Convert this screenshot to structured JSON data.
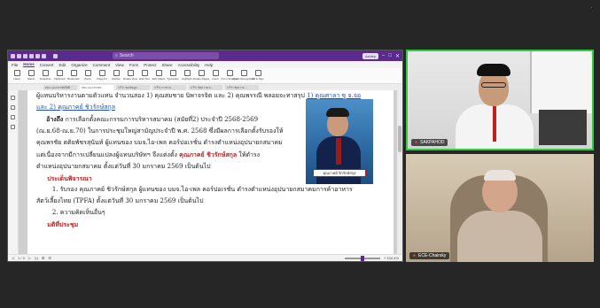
{
  "screen": {
    "background": "#262626",
    "corner_glyph": "·"
  },
  "editor": {
    "accent_color": "#5a2a8c",
    "search_placeholder": "Search",
    "account_pill": "Ashley",
    "window_controls": [
      "–",
      "□",
      "✕"
    ],
    "menu": [
      "File",
      "Home",
      "Convert",
      "Edit",
      "Organize",
      "Comment",
      "View",
      "Form",
      "Protect",
      "Share",
      "Accessibility",
      "Help"
    ],
    "active_menu": "Home",
    "ribbon": [
      "Hand",
      "Select",
      "Snapshot",
      "Clipboard",
      "Bookmark",
      "Zoom",
      "Page Fit",
      "Reflow",
      "Rotate View",
      "Edit Text",
      "Edit Object",
      "Typewriter",
      "Highlight",
      "Rotate Pages",
      "Insert",
      "From Scanner",
      "Quick Recognition",
      "Fill & Sign"
    ],
    "doc_tabs": [
      "PDA card ทางทิศใต้ดี...",
      "PDA card ทางสถ...",
      "3 รีวิว ของข้อมูล...",
      "3 รีวิว การสาม...",
      "3 รีวิว ข้อความเห...",
      "3 รีวิว ข้อความ..."
    ],
    "status_items": [
      "◁",
      "1 / 3",
      "▷",
      "▷|",
      "⊞",
      "⊟"
    ],
    "zoom_label": "+ 104.4%"
  },
  "document": {
    "line0": "ผู้แทนบริหารงานตามตัวแทน จำนวนสอง 1) คุณสมชาย นิพาจรจิต และ 2) คุณพรรณี พลอยจะทาสรุป",
    "line0_link": "1) คุณศาลา ซู จ.จอ",
    "line1": "และ 2) คุณภาคย์ ชิวรักษ์สกุล",
    "line2_bold": "อ้างถึง",
    "line2": " การเลือกตั้งคณะกรรมการบริหารสมาคม (สมัยที่2) ประจำปี 2568-2569",
    "line3": "(ณ.ย.68-ณ.ย.70) ในการประชุมใหญ่สามัญประจำปี พ.ศ. 2568 ซึ่งมีผลการเลือกตั้งรับรองให้",
    "line4": "คุณพรชัย ตติยพัชรสุนันท์ ผู้แทนของ บมจ.ไอ-เพล คอร์ปอเรชั่น ดำรงตำแหน่งอุปนายกสมาคม",
    "line5_pre": "แต่เนื่องจากมีการเปลี่ยนแปลงผู้แทนบริษัทฯ จึงแต่งตั้ง ",
    "line5_hl": "คุณภาคย์ ชิวรักษ์สกุล",
    "line5_post": " ให้ดำรง",
    "line6": "ตำแหน่งอุปนายกสมาคม ตั้งแต่วันที่ 30 มกราคม 2569 เป็นต้นไป",
    "section1": "ประเด็นพิจารณา",
    "item1": "1. รับรอง คุณภาคย์ ชิวรักษ์สกุล ผู้แทนของ บมจ.ไอ-เพล คอร์ปอเรชั่น ดำรงตำแหน่งอุปนายกสมาคมการค้าอาหาร",
    "item1b": "สัตว์เลี้ยงไทย (TPFA) ตั้งแต่วันที่ 30 มกราคม 2569 เป็นต้นไป",
    "item2": "2. ความคิดเห็นอื่นๆ",
    "section2": "มติที่ประชุม",
    "photo_caption": "คุณภาคย์ ชิวรักษ์สกุล"
  },
  "participants": [
    {
      "name": "SAKPAHOD",
      "mic": "muted",
      "speaking": true
    },
    {
      "name": "ECE-Chairsky",
      "mic": "muted",
      "speaking": false
    }
  ],
  "colors": {
    "speaking_border": "#2ecc40",
    "highlight_red": "#c02020",
    "link_blue": "#2050c0"
  }
}
